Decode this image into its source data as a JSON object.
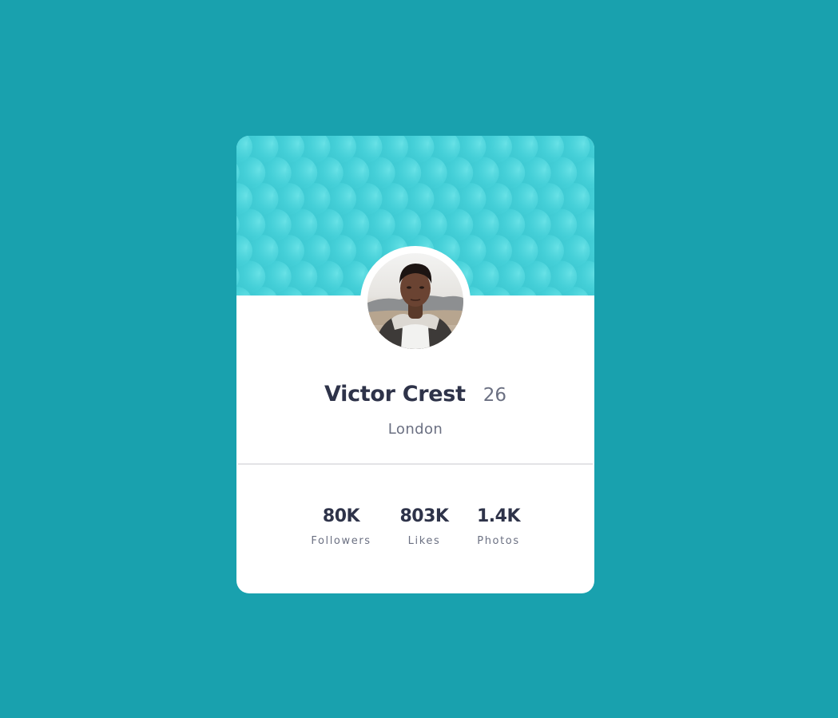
{
  "profile": {
    "name": "Victor Crest",
    "age": "26",
    "city": "London"
  },
  "stats": {
    "followers": {
      "value": "80K",
      "label": "Followers"
    },
    "likes": {
      "value": "803K",
      "label": "Likes"
    },
    "photos": {
      "value": "1.4K",
      "label": "Photos"
    }
  },
  "colors": {
    "page_background": "#19a1ae",
    "banner": "#3ec9d2",
    "card": "#ffffff",
    "heading_text": "#2e3349",
    "muted_text": "#6b7082",
    "divider": "#e3e3e6"
  }
}
